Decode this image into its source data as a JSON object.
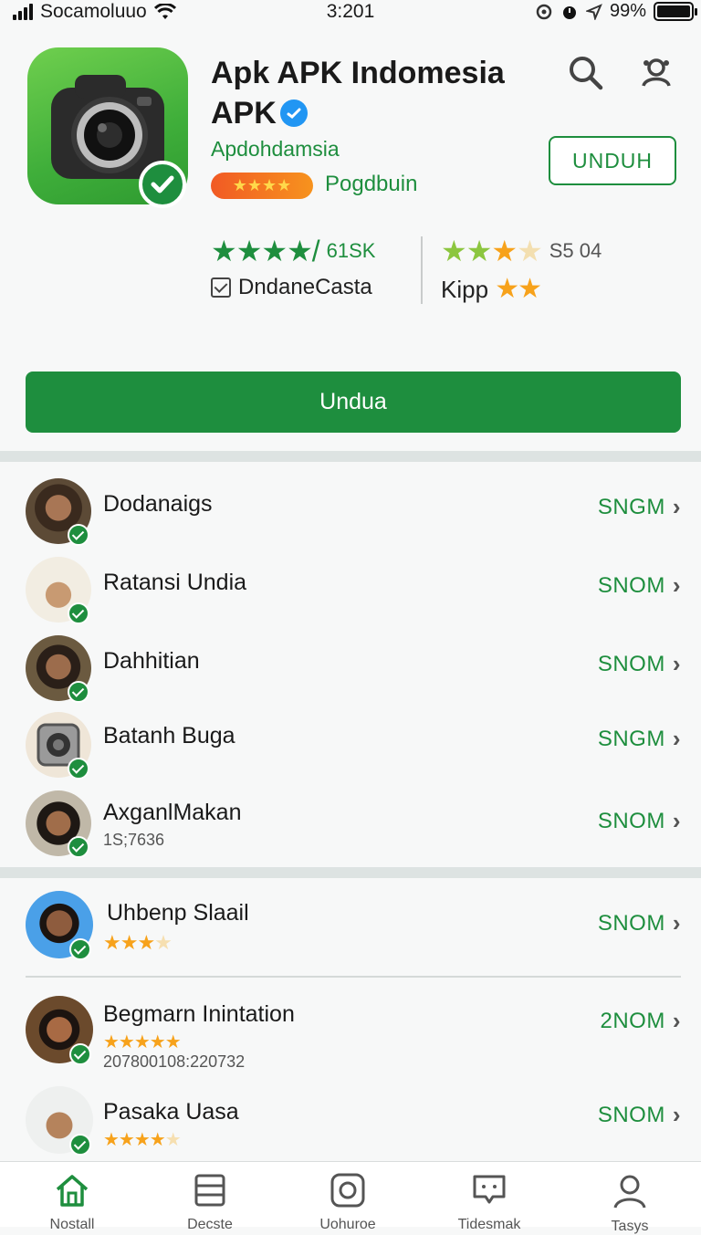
{
  "status_bar": {
    "carrier": "Socamoluuo",
    "time": "3:201",
    "battery": "99%"
  },
  "app": {
    "title_line1": "Apk APK Indomesia",
    "title_line2": "APK",
    "developer": "Apdohdamsia",
    "rating_pill_stars": "★★★★",
    "category": "Pogdbuin",
    "install_outline_label": "UNDUH",
    "stat_left_stars": "★★★★/",
    "stat_left_count": "61SK",
    "stat_left_label": "DndaneCasta",
    "stat_right_count": "S5 04",
    "stat_right_label": "Kipp",
    "main_button_label": "Undua",
    "colors": {
      "accent": "#1e8e3e",
      "star": "#f7a21b"
    }
  },
  "list_section_1": [
    {
      "name": "Dodanaigs",
      "action": "SNGM"
    },
    {
      "name": "Ratansi Undia",
      "action": "SNOM"
    },
    {
      "name": "Dahhitian",
      "action": "SNOM"
    },
    {
      "name": "Batanh Buga",
      "action": "SNGM"
    },
    {
      "name": "AxganlMakan",
      "sub": "1S;7636",
      "action": "SNOM"
    }
  ],
  "list_section_2": [
    {
      "name": "Uhbenp Slaail",
      "action": "SNOM",
      "stars": "★★★"
    },
    {
      "name": "Begmarn Inintation",
      "sub": "207800108:220732",
      "action": "2NOM",
      "stars": "★★★★★"
    },
    {
      "name": "Pasaka Uasa",
      "action": "SNOM",
      "stars": "★★★★"
    }
  ],
  "bottom_nav": [
    {
      "label": "Nostall",
      "icon": "home-icon"
    },
    {
      "label": "Decste",
      "icon": "book-icon"
    },
    {
      "label": "Uohuroe",
      "icon": "instagram-icon"
    },
    {
      "label": "Tidesmak",
      "icon": "chat-icon"
    },
    {
      "label": "Tasys",
      "icon": "user-icon"
    }
  ]
}
